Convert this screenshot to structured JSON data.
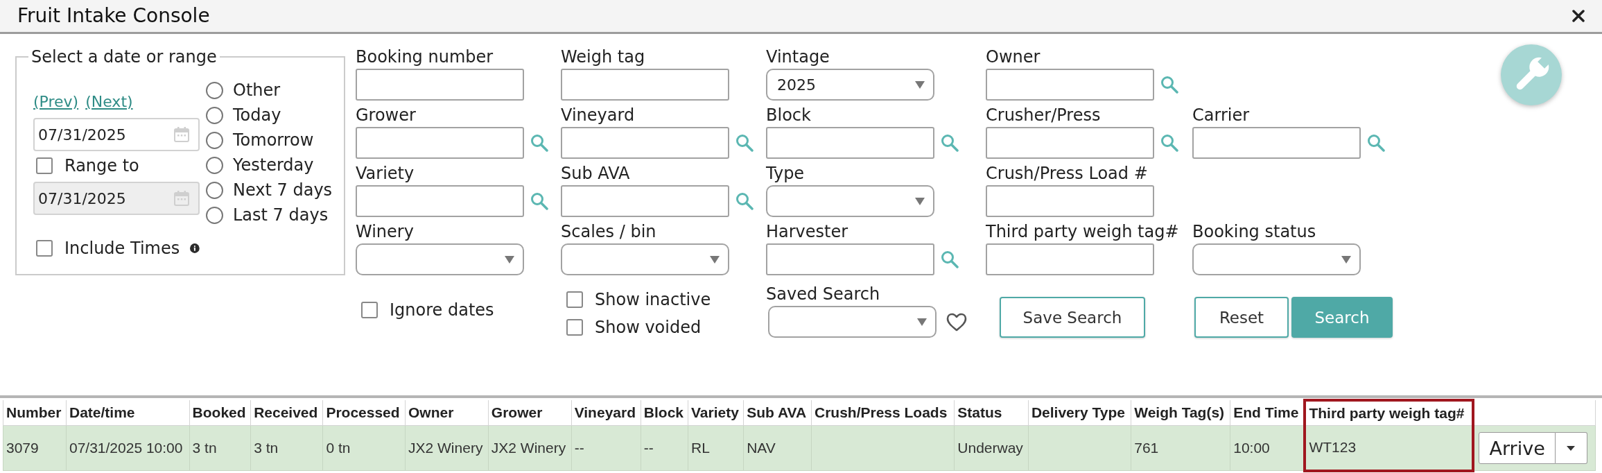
{
  "window": {
    "title": "Fruit Intake Console"
  },
  "date_range": {
    "legend": "Select a date or range",
    "prev_link": "(Prev)",
    "next_link": "(Next)",
    "from_date": "07/31/2025",
    "range_to": {
      "label": "Range to",
      "checked": false
    },
    "to_date": {
      "value": "07/31/2025",
      "disabled": true
    },
    "include_times": {
      "label": "Include Times",
      "checked": false
    },
    "presets": [
      {
        "label": "Other",
        "selected": false
      },
      {
        "label": "Today",
        "selected": false
      },
      {
        "label": "Tomorrow",
        "selected": false
      },
      {
        "label": "Yesterday",
        "selected": false
      },
      {
        "label": "Next 7 days",
        "selected": false
      },
      {
        "label": "Last 7 days",
        "selected": false
      }
    ]
  },
  "filter_rows": [
    [
      {
        "label": "Booking number",
        "kind": "text"
      },
      {
        "label": "Weigh tag",
        "kind": "text"
      },
      {
        "label": "Vintage",
        "kind": "select",
        "value": "2025"
      },
      {
        "label": "Owner",
        "kind": "lookup"
      }
    ],
    [
      {
        "label": "Grower",
        "kind": "lookup"
      },
      {
        "label": "Vineyard",
        "kind": "lookup"
      },
      {
        "label": "Block",
        "kind": "lookup"
      },
      {
        "label": "Crusher/Press",
        "kind": "lookup"
      },
      {
        "label": "Carrier",
        "kind": "lookup"
      }
    ],
    [
      {
        "label": "Variety",
        "kind": "lookup"
      },
      {
        "label": "Sub AVA",
        "kind": "lookup"
      },
      {
        "label": "Type",
        "kind": "select"
      },
      {
        "label": "Crush/Press Load #",
        "kind": "text"
      }
    ],
    [
      {
        "label": "Winery",
        "kind": "select"
      },
      {
        "label": "Scales / bin",
        "kind": "select"
      },
      {
        "label": "Harvester",
        "kind": "lookup"
      },
      {
        "label": "Third party weigh tag#",
        "kind": "text"
      },
      {
        "label": "Booking status",
        "kind": "select"
      }
    ]
  ],
  "options": {
    "ignore_dates": {
      "label": "Ignore dates",
      "checked": false
    },
    "show_inactive": {
      "label": "Show inactive",
      "checked": false
    },
    "show_voided": {
      "label": "Show voided",
      "checked": false
    }
  },
  "saved_search": {
    "label": "Saved Search"
  },
  "save_search_button": {
    "label": "Save Search"
  },
  "buttons": [
    {
      "label": "Reset",
      "kind": "outline"
    },
    {
      "label": "Search",
      "kind": "primary"
    }
  ],
  "table": {
    "columns": [
      {
        "label": "Number",
        "highlighted": false
      },
      {
        "label": "Date/time",
        "highlighted": false
      },
      {
        "label": "Booked",
        "highlighted": false
      },
      {
        "label": "Received",
        "highlighted": false
      },
      {
        "label": "Processed",
        "highlighted": false
      },
      {
        "label": "Owner",
        "highlighted": false
      },
      {
        "label": "Grower",
        "highlighted": false
      },
      {
        "label": "Vineyard",
        "highlighted": false
      },
      {
        "label": "Block",
        "highlighted": false
      },
      {
        "label": "Variety",
        "highlighted": false
      },
      {
        "label": "Sub AVA",
        "highlighted": false
      },
      {
        "label": "Crush/Press Loads",
        "highlighted": false
      },
      {
        "label": "Status",
        "highlighted": false
      },
      {
        "label": "Delivery Type",
        "highlighted": false
      },
      {
        "label": "Weigh Tag(s)",
        "highlighted": false
      },
      {
        "label": "End Time",
        "highlighted": false
      },
      {
        "label": "Third party weigh tag#",
        "highlighted": true
      }
    ],
    "rows": [
      {
        "cells": [
          "3079",
          "07/31/2025 10:00",
          "3 tn",
          "3 tn",
          "0 tn",
          "JX2 Winery",
          "JX2 Winery",
          "--",
          "--",
          "RL",
          "NAV",
          null,
          "Underway",
          null,
          "761",
          "10:00",
          "WT123"
        ],
        "action": {
          "label": "Arrive"
        }
      }
    ]
  }
}
